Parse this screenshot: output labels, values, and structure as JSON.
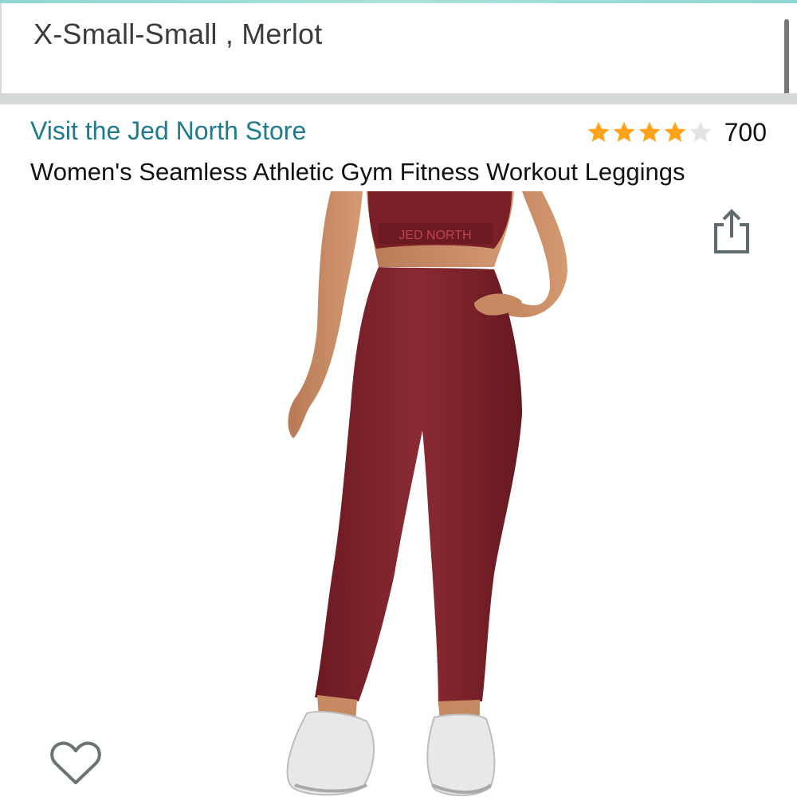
{
  "variant": {
    "selection": "X-Small-Small , Merlot"
  },
  "product": {
    "store_link": "Visit the Jed North Store",
    "rating_stars": 4,
    "rating_max": 5,
    "rating_count": "700",
    "title": "Women's Seamless Athletic Gym Fitness Workout Leggings",
    "image_band_text": "JED NORTH"
  },
  "icons": {
    "share": "share-icon",
    "wishlist": "heart-outline-icon",
    "star": "star-icon"
  },
  "colors": {
    "store_link": "#1f7a8c",
    "star_filled": "#ffa41c",
    "star_empty": "#e3e3e3",
    "accent_bar": "#8fd6d6",
    "product": "#7a1f28"
  }
}
